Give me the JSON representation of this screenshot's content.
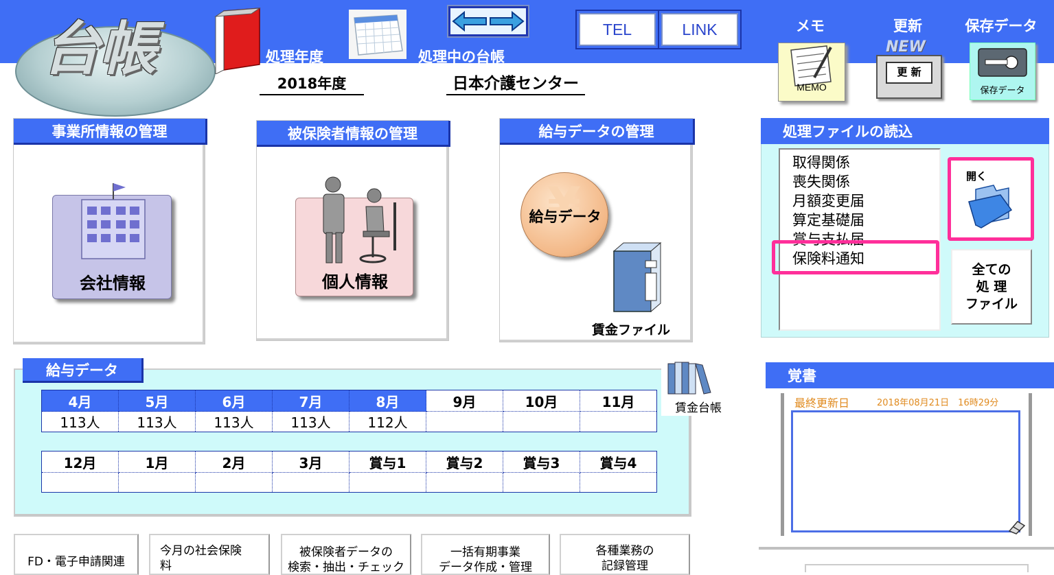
{
  "header": {
    "logo": "台帳",
    "year_label": "処理年度",
    "year_value": "2018年度",
    "ledger_label": "処理中の台帳",
    "ledger_value": "日本介護センター",
    "tel_label": "TEL",
    "link_label": "LINK",
    "tools": [
      {
        "label": "メモ",
        "icon_text": "MEMO"
      },
      {
        "label": "更新",
        "icon_text": "更 新",
        "icon_sub": "NEW"
      },
      {
        "label": "保存データ",
        "icon_text": "保存データ"
      }
    ]
  },
  "panels": {
    "office": {
      "title": "事業所情報の管理",
      "button": "会社情報"
    },
    "insured": {
      "title": "被保険者情報の管理",
      "button": "個人情報"
    },
    "salary": {
      "title": "給与データの管理",
      "button": "給与データ",
      "file_label": "賃金ファイル"
    }
  },
  "read_files": {
    "title": "処理ファイルの読込",
    "items": [
      "取得関係",
      "喪失関係",
      "月額変更届",
      "算定基礎届",
      "賞与支払届",
      "保険料通知"
    ],
    "open_label": "開く",
    "all_files_label": [
      "全ての",
      "処 理",
      "ファイル"
    ]
  },
  "salary_data": {
    "title": "給与データ",
    "row1_months": [
      "4月",
      "5月",
      "6月",
      "7月",
      "8月",
      "9月",
      "10月",
      "11月"
    ],
    "row1_values": [
      "113人",
      "113人",
      "113人",
      "113人",
      "112人",
      "",
      "",
      ""
    ],
    "row2_months": [
      "12月",
      "1月",
      "2月",
      "3月",
      "賞与1",
      "賞与2",
      "賞与3",
      "賞与4"
    ],
    "row2_values": [
      "",
      "",
      "",
      "",
      "",
      "",
      "",
      ""
    ],
    "ledger_label": "賃金台帳"
  },
  "memo": {
    "title": "覚書",
    "last_update_label": "最終更新日",
    "last_update_value": "2018年08月21日　16時29分"
  },
  "bottom_buttons": [
    {
      "line1": "FD・電子申請関連",
      "line2": ""
    },
    {
      "line1": "今月の社会保険",
      "line2": "料"
    },
    {
      "line1": "被保険者データの",
      "line2": "検索・抽出・チェック"
    },
    {
      "line1": "一括有期事業",
      "line2": "データ作成・管理"
    },
    {
      "line1": "各種業務の",
      "line2": "記録管理"
    }
  ],
  "colors": {
    "accent": "#3f6ef5",
    "highlight": "#ff2f9a",
    "panel_bg": "#cffafa",
    "memo_date": "#e08a1e"
  }
}
